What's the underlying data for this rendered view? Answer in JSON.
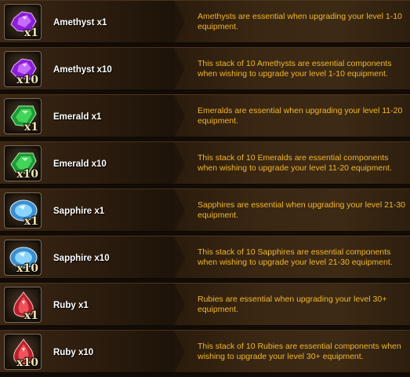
{
  "items": [
    {
      "name": "Amethyst x1",
      "qty": "x1",
      "gem": "amethyst-icon",
      "color": "#b54bf0",
      "desc": "Amethysts are essential when upgrading your level 1-10 equipment."
    },
    {
      "name": "Amethyst x10",
      "qty": "x10",
      "gem": "amethyst-icon",
      "color": "#b54bf0",
      "desc": "This stack of 10 Amethysts are essential components when wishing to upgrade your level 1-10 equipment."
    },
    {
      "name": "Emerald x1",
      "qty": "x1",
      "gem": "emerald-icon",
      "color": "#35c64a",
      "desc": "Emeralds are essential when upgrading your level 11-20 equipment."
    },
    {
      "name": "Emerald x10",
      "qty": "x10",
      "gem": "emerald-icon",
      "color": "#35c64a",
      "desc": "This stack of 10 Emeralds are essential components when wishing to upgrade your level 11-20 equipment."
    },
    {
      "name": "Sapphire x1",
      "qty": "x1",
      "gem": "sapphire-icon",
      "color": "#7fc8f2",
      "desc": "Sapphires are essential when upgrading your level 21-30 equipment."
    },
    {
      "name": "Sapphire x10",
      "qty": "x10",
      "gem": "sapphire-icon",
      "color": "#7fc8f2",
      "desc": "This stack of 10 Sapphires are essential components when wishing to upgrade your level 21-30 equipment."
    },
    {
      "name": "Ruby x1",
      "qty": "x1",
      "gem": "ruby-icon",
      "color": "#e24a4a",
      "desc": "Rubies are essential when upgrading your level 30+ equipment."
    },
    {
      "name": "Ruby x10",
      "qty": "x10",
      "gem": "ruby-icon",
      "color": "#e24a4a",
      "desc": "This stack of 10 Rubies are essential components when wishing to upgrade your level 30+ equipment."
    }
  ]
}
